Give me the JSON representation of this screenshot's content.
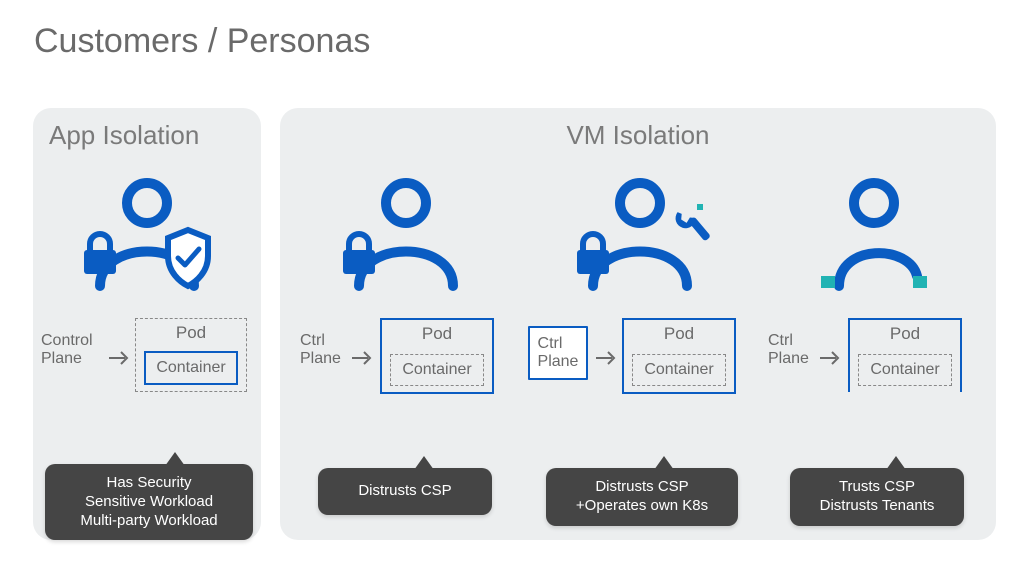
{
  "title": "Customers / Personas",
  "panels": {
    "app": {
      "title": "App Isolation"
    },
    "vm": {
      "title": "VM Isolation"
    }
  },
  "columns": {
    "c0": {
      "persona": "lock-shield",
      "ctrl_label": "Control\nPlane",
      "ctrl_boxed": false,
      "pod_style": "dashed",
      "pod_label": "Pod",
      "inner_style": "solid",
      "inner_label": "Container",
      "callout": "Has Security\nSensitive Workload\nMulti-party Workload"
    },
    "c1": {
      "persona": "lock",
      "ctrl_label": "Ctrl\nPlane",
      "ctrl_boxed": false,
      "pod_style": "solid",
      "pod_label": "Pod",
      "inner_style": "dashed",
      "inner_label": "Container",
      "callout": "Distrusts CSP"
    },
    "c2": {
      "persona": "lock-wrench",
      "ctrl_label": "Ctrl\nPlane",
      "ctrl_boxed": true,
      "pod_style": "solid",
      "pod_label": "Pod",
      "inner_style": "dashed",
      "inner_label": "Container",
      "callout": "Distrusts CSP\n+Operates own K8s"
    },
    "c3": {
      "persona": "tenant",
      "ctrl_label": "Ctrl\nPlane",
      "ctrl_boxed": false,
      "pod_style": "bottomless",
      "pod_label": "Pod",
      "inner_style": "dashed",
      "inner_label": "Container",
      "callout": "Trusts CSP\nDistrusts Tenants"
    }
  }
}
